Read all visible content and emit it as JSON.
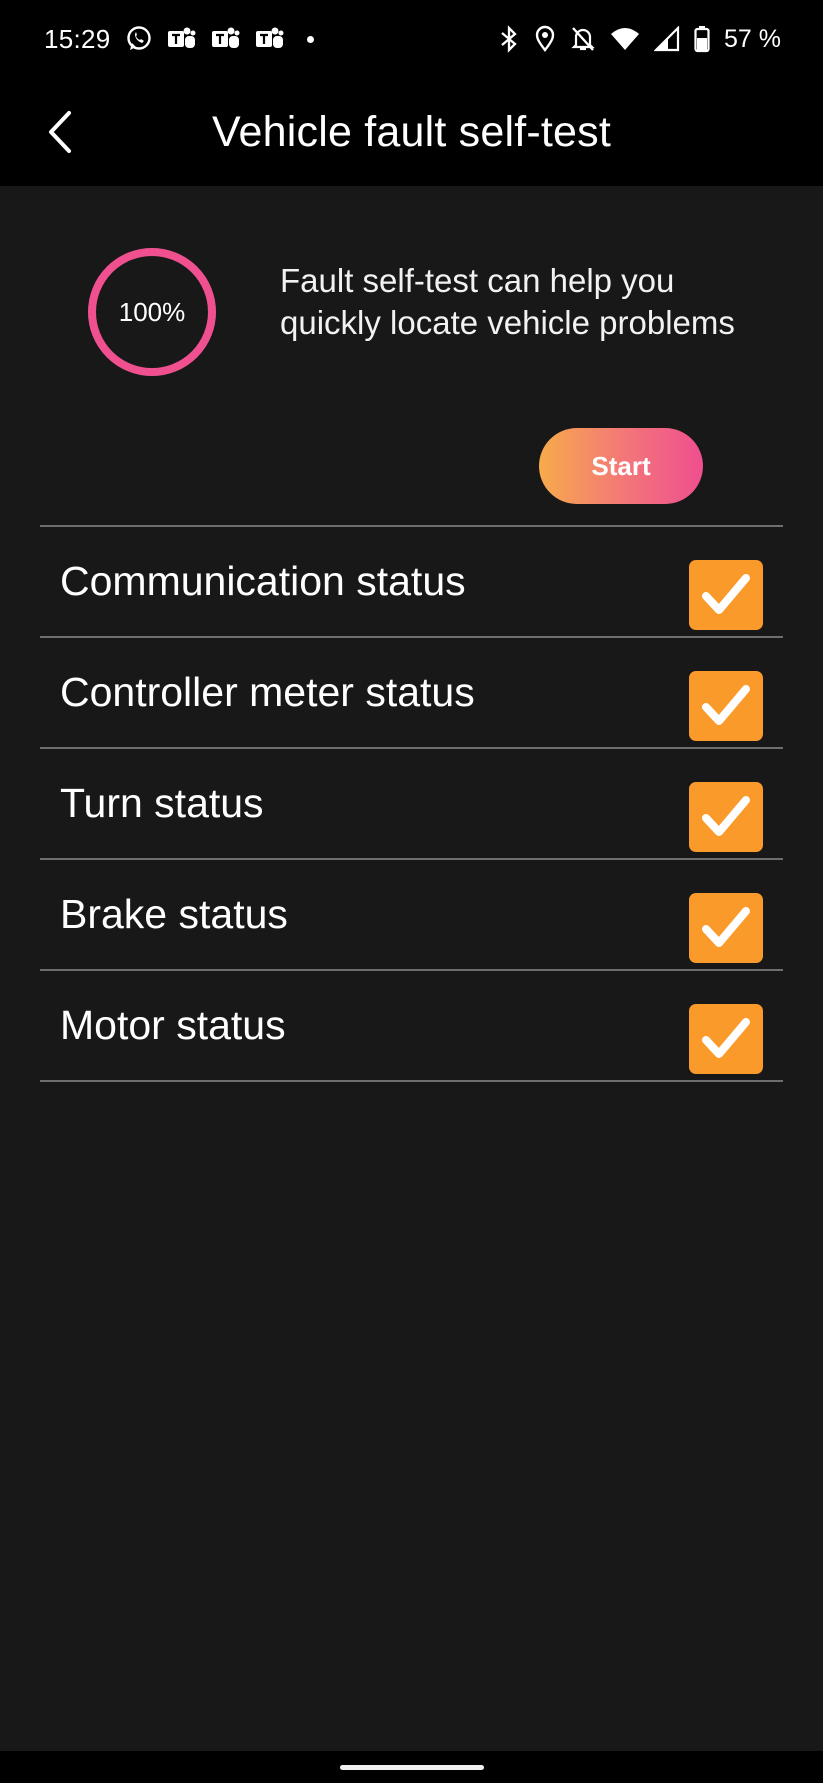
{
  "status_bar": {
    "time": "15:29",
    "left_icons": [
      "whatsapp-icon",
      "teams-icon",
      "teams-icon",
      "teams-icon",
      "dot-icon"
    ],
    "right_icons": [
      "bluetooth-icon",
      "location-icon",
      "bell-off-icon",
      "wifi-icon",
      "signal-icon",
      "battery-icon"
    ],
    "battery": "57 %"
  },
  "app_bar": {
    "back_icon": "chevron-left-icon",
    "title": "Vehicle fault self-test"
  },
  "self_test": {
    "progress_label": "100%",
    "progress_fraction": 1.0,
    "ring_color": "#f0508f",
    "description": "Fault self-test can help you quickly locate vehicle problems",
    "start_label": "Start"
  },
  "checks": [
    {
      "label": "Communication status",
      "checked": true
    },
    {
      "label": "Controller meter status",
      "checked": true
    },
    {
      "label": "Turn status",
      "checked": true
    },
    {
      "label": "Brake status",
      "checked": true
    },
    {
      "label": "Motor status",
      "checked": true
    }
  ],
  "colors": {
    "background": "#181818",
    "bar": "#000000",
    "check_fill": "#fa9a2a",
    "divider": "#6e6e6e"
  }
}
